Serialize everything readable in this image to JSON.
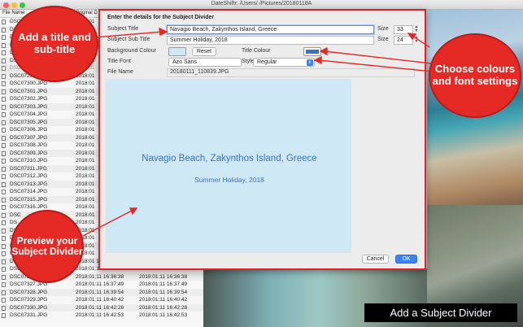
{
  "window": {
    "title": "DateShiftr: /Users/     /Pictures/20180118A"
  },
  "file_list": {
    "headers": {
      "name": "File Name",
      "original": "Original D"
    },
    "rows": [
      {
        "name": "DSC0",
        "orig": "2018:01",
        "new": ""
      },
      {
        "name": "DSC0",
        "orig": "2018:01",
        "new": ""
      },
      {
        "name": "DSC0",
        "orig": "2018:01",
        "new": ""
      },
      {
        "name": "DSC0",
        "orig": "2018:01",
        "new": ""
      },
      {
        "name": "DSC0",
        "orig": "2018:01",
        "new": ""
      },
      {
        "name": "DSC0",
        "orig": "2018:01",
        "new": ""
      },
      {
        "name": "DSC0",
        "orig": "2018:01",
        "new": ""
      },
      {
        "name": "DSC07299.JPG",
        "orig": "2018:01",
        "new": ""
      },
      {
        "name": "DSC07300.JPG",
        "orig": "2018:01",
        "new": ""
      },
      {
        "name": "DSC07301.JPG",
        "orig": "2018:01",
        "new": ""
      },
      {
        "name": "DSC07302.JPG",
        "orig": "2018:01",
        "new": ""
      },
      {
        "name": "DSC07303.JPG",
        "orig": "2018:01",
        "new": ""
      },
      {
        "name": "DSC07304.JPG",
        "orig": "2018:01",
        "new": ""
      },
      {
        "name": "DSC07305.JPG",
        "orig": "2018:01",
        "new": ""
      },
      {
        "name": "DSC07306.JPG",
        "orig": "2018:01",
        "new": ""
      },
      {
        "name": "DSC07307.JPG",
        "orig": "2018:01",
        "new": ""
      },
      {
        "name": "DSC07308.JPG",
        "orig": "2018:01",
        "new": ""
      },
      {
        "name": "DSC07309.JPG",
        "orig": "2018:01",
        "new": ""
      },
      {
        "name": "DSC07310.JPG",
        "orig": "2018:01",
        "new": ""
      },
      {
        "name": "DSC07311.JPG",
        "orig": "2018:01",
        "new": ""
      },
      {
        "name": "DSC07312.JPG",
        "orig": "2018:01",
        "new": ""
      },
      {
        "name": "DSC07313.JPG",
        "orig": "2018:01",
        "new": ""
      },
      {
        "name": "DSC07314.JPG",
        "orig": "2018:01",
        "new": ""
      },
      {
        "name": "DSC07315.JPG",
        "orig": "2018:01",
        "new": ""
      },
      {
        "name": "DSC07316.JPG",
        "orig": "2018:01",
        "new": ""
      },
      {
        "name": "DSC",
        "orig": "2018:01",
        "new": ""
      },
      {
        "name": "DS",
        "orig": "2018:01",
        "new": ""
      },
      {
        "name": "DS",
        "orig": "2018:01",
        "new": ""
      },
      {
        "name": "DS",
        "orig": "2018:01",
        "new": ""
      },
      {
        "name": "DS",
        "orig": "2018:01",
        "new": ""
      },
      {
        "name": "DS",
        "orig": "2018:01",
        "new": ""
      },
      {
        "name": "DS",
        "orig": "2018:01 16:33:31",
        "new": "2018:01:11 16:33:31"
      },
      {
        "name": "DSC07325.JPG",
        "orig": "2018:01:11 16:36:27",
        "new": "2018:01:11 16:36:27"
      },
      {
        "name": "DSC07326.JPG",
        "orig": "2018:01:11 16:36:38",
        "new": "2018:01:11 16:36:38"
      },
      {
        "name": "DSC07327.JPG",
        "orig": "2018:01:11 16:37:49",
        "new": "2018:01:11 16:37:49"
      },
      {
        "name": "DSC07328.JPG",
        "orig": "2018:01:11 16:39:54",
        "new": "2018:01:11 16:39:54"
      },
      {
        "name": "DSC07329.JPG",
        "orig": "2018:01:11 16:40:42",
        "new": "2018:01:11 16:40:42"
      },
      {
        "name": "DSC07330.JPG",
        "orig": "2018:01:11 16:42:28",
        "new": "2018:01:11 16:42:28"
      },
      {
        "name": "DSC07331.JPG",
        "orig": "2018:01:11 16:42:53",
        "new": "2018:01:11 16:42:53"
      }
    ]
  },
  "dialog": {
    "heading": "Enter the details for the Subject Divider",
    "subject_title_label": "Subject Title",
    "subject_title_value": "Navagio Beach, Zakynthos Island, Greece",
    "subject_subtitle_label": "Subject Sub Title",
    "subject_subtitle_value": "Summer Holiday, 2018",
    "size_label": "Size",
    "title_size": "33",
    "subtitle_size": "24",
    "background_colour_label": "Background Colour",
    "background_colour": "#cfe8f5",
    "reset_label": "Reset",
    "title_colour_label": "Title Colour",
    "title_colour": "#3a72c4",
    "title_font_label": "Title Font",
    "title_font_value": "Azo Sans",
    "style_label": "Style",
    "style_value": "Regular",
    "file_name_label": "File Name",
    "file_name_value": "20180111_110839.JPG",
    "cancel_label": "Cancel",
    "ok_label": "OK"
  },
  "preview": {
    "title": "Navagio Beach, Zakynthos Island, Greece",
    "subtitle": "Summer Holiday, 2018"
  },
  "callouts": {
    "add_title": "Add a title and sub-title",
    "preview": "Preview your Subject Divider",
    "colours": "Choose colours and font settings"
  },
  "banner": "Add a Subject Divider",
  "colors": {
    "accent_red": "#e52a26",
    "ok_blue": "#3a82f7"
  },
  "icons": {
    "stepper": "updown-stepper-icon",
    "popup": "popup-chevron-icon",
    "file": "file-icon"
  }
}
